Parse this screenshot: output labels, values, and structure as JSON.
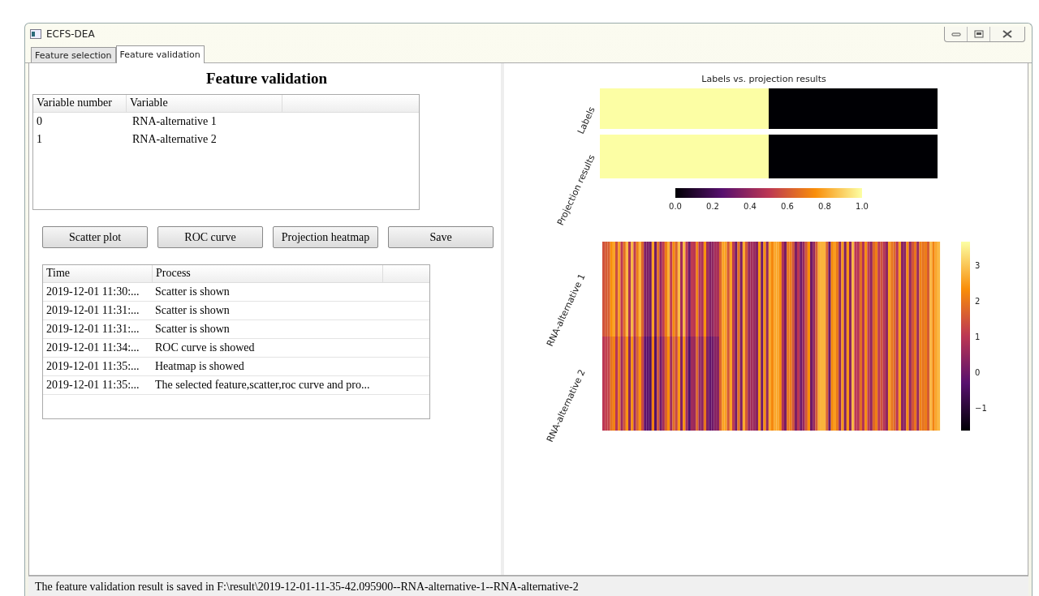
{
  "window": {
    "title": "ECFS-DEA"
  },
  "tabs": [
    {
      "label": "Feature selection",
      "selected": false
    },
    {
      "label": "Feature validation",
      "selected": true
    }
  ],
  "heading": "Feature validation",
  "variables_table": {
    "columns": [
      "Variable number",
      "Variable"
    ],
    "rows": [
      [
        "0",
        "RNA-alternative 1"
      ],
      [
        "1",
        "RNA-alternative 2"
      ]
    ]
  },
  "buttons": [
    "Scatter plot",
    "ROC curve",
    "Projection heatmap",
    "Save"
  ],
  "log_table": {
    "columns": [
      "Time",
      "Process"
    ],
    "rows": [
      [
        "2019-12-01 11:30:...",
        "Scatter is shown"
      ],
      [
        "2019-12-01 11:31:...",
        "Scatter is shown"
      ],
      [
        "2019-12-01 11:31:...",
        "Scatter is shown"
      ],
      [
        "2019-12-01 11:34:...",
        "ROC curve is showed"
      ],
      [
        "2019-12-01 11:35:...",
        "Heatmap is showed"
      ],
      [
        "2019-12-01 11:35:...",
        "The selected feature,scatter,roc curve and pro..."
      ]
    ]
  },
  "projection_heatmap": {
    "title": "Labels vs. projection results",
    "row_labels": [
      "Labels",
      "Projection results"
    ],
    "colorbar_ticks": [
      "0.0",
      "0.2",
      "0.4",
      "0.6",
      "0.8",
      "1.0"
    ]
  },
  "feature_heatmap": {
    "row_labels": [
      "RNA-alternative 1",
      "RNA-alternative 2"
    ],
    "colorbar_ticks": [
      "3",
      "2",
      "1",
      "0",
      "−1"
    ]
  },
  "status_bar": "The feature validation result is saved in F:\\result\\2019-12-01-11-35-42.095900--RNA-alternative-1--RNA-alternative-2"
}
